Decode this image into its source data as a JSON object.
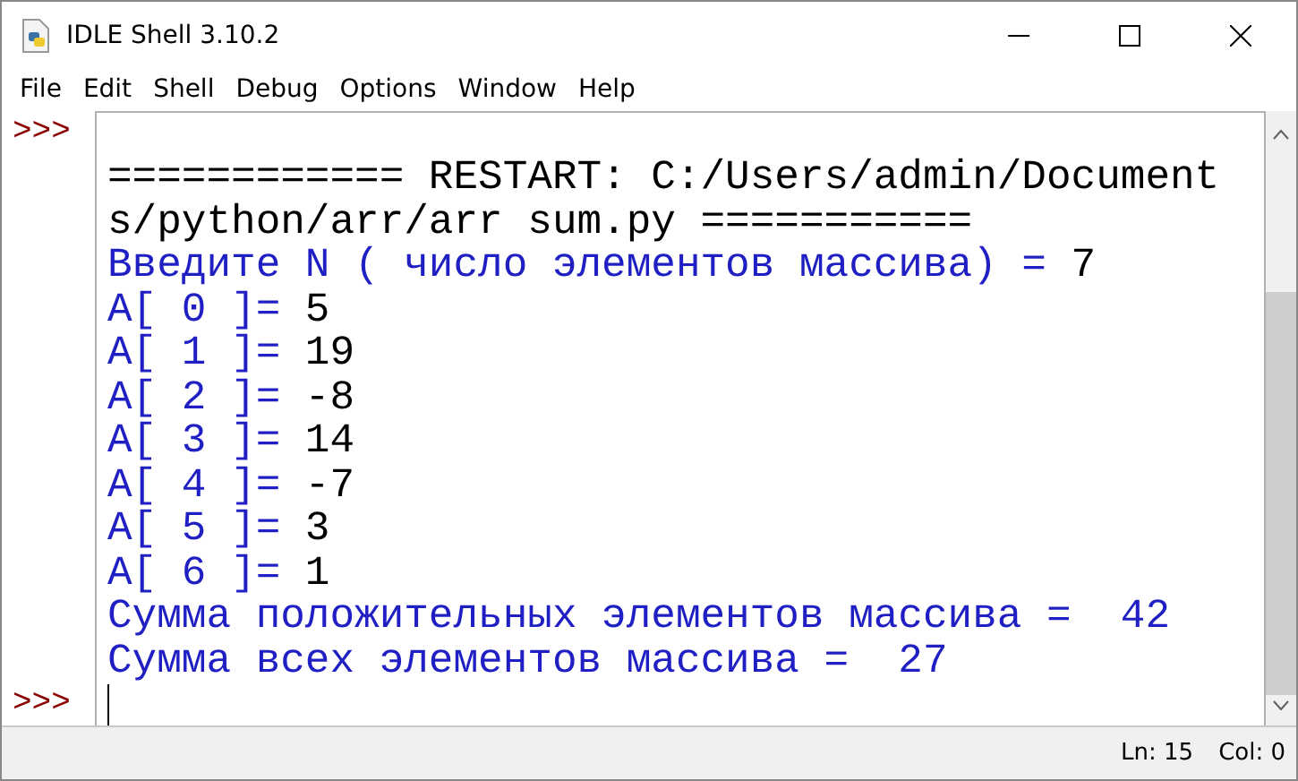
{
  "window": {
    "title": "IDLE Shell 3.10.2"
  },
  "menu": [
    "File",
    "Edit",
    "Shell",
    "Debug",
    "Options",
    "Window",
    "Help"
  ],
  "shell": {
    "lines": [
      {
        "prompt": ">>>"
      },
      {
        "segments": [
          {
            "kind": "system",
            "text": "============ RESTART: C:/Users/admin/Document"
          }
        ]
      },
      {
        "segments": [
          {
            "kind": "system",
            "text": "s/python/arr/arr sum.py ==========="
          }
        ]
      },
      {
        "segments": [
          {
            "kind": "output",
            "text": "Введите N ( число элементов массива) = "
          },
          {
            "kind": "input",
            "text": "7"
          }
        ]
      },
      {
        "segments": [
          {
            "kind": "output",
            "text": "A[ 0 ]= "
          },
          {
            "kind": "input",
            "text": "5"
          }
        ]
      },
      {
        "segments": [
          {
            "kind": "output",
            "text": "A[ 1 ]= "
          },
          {
            "kind": "input",
            "text": "19"
          }
        ]
      },
      {
        "segments": [
          {
            "kind": "output",
            "text": "A[ 2 ]= "
          },
          {
            "kind": "input",
            "text": "-8"
          }
        ]
      },
      {
        "segments": [
          {
            "kind": "output",
            "text": "A[ 3 ]= "
          },
          {
            "kind": "input",
            "text": "14"
          }
        ]
      },
      {
        "segments": [
          {
            "kind": "output",
            "text": "A[ 4 ]= "
          },
          {
            "kind": "input",
            "text": "-7"
          }
        ]
      },
      {
        "segments": [
          {
            "kind": "output",
            "text": "A[ 5 ]= "
          },
          {
            "kind": "input",
            "text": "3"
          }
        ]
      },
      {
        "segments": [
          {
            "kind": "output",
            "text": "A[ 6 ]= "
          },
          {
            "kind": "input",
            "text": "1"
          }
        ]
      },
      {
        "segments": [
          {
            "kind": "output",
            "text": "Сумма положительных элементов массива =  42"
          }
        ]
      },
      {
        "segments": [
          {
            "kind": "output",
            "text": "Сумма всех элементов массива =  27"
          }
        ]
      },
      {
        "prompt": ">>>",
        "cursor": true
      }
    ]
  },
  "status_bar": {
    "line": "Ln: 15",
    "column": "Col: 0"
  }
}
